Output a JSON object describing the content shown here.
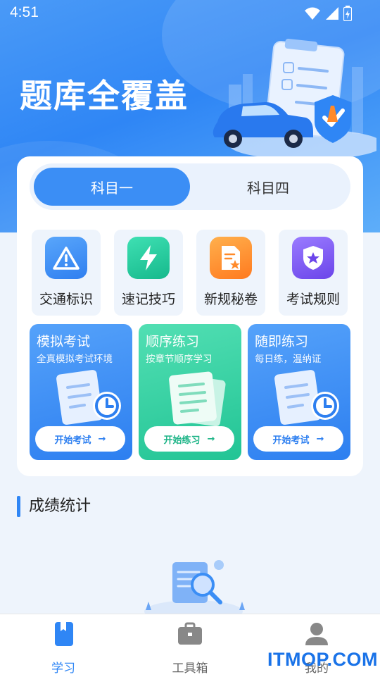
{
  "status_bar": {
    "time": "4:51"
  },
  "hero": {
    "title": "题库全覆盖"
  },
  "subject_tabs": [
    {
      "label": "科目一",
      "active": true
    },
    {
      "label": "科目四",
      "active": false
    }
  ],
  "quick_entries": [
    {
      "label": "交通标识",
      "icon": "warning-icon",
      "color": "#2f86f5"
    },
    {
      "label": "速记技巧",
      "icon": "lightning-icon",
      "color": "#1fc49b"
    },
    {
      "label": "新规秘卷",
      "icon": "document-star-icon",
      "color": "#ff8a2a"
    },
    {
      "label": "考试规则",
      "icon": "shield-star-icon",
      "color": "#7a55f2"
    }
  ],
  "practice_modes": [
    {
      "title": "模拟考试",
      "subtitle": "全真模拟考试环境",
      "button": "开始考试",
      "color": "#3b8ef5"
    },
    {
      "title": "顺序练习",
      "subtitle": "按章节顺序学习",
      "button": "开始练习",
      "color": "#2ccf9e"
    },
    {
      "title": "随即练习",
      "subtitle": "每日练，温纳证",
      "button": "开始考试",
      "color": "#3b8ef5"
    }
  ],
  "section": {
    "title": "成绩统计"
  },
  "bottom_nav": [
    {
      "label": "学习",
      "icon": "bookmark-book-icon",
      "active": true
    },
    {
      "label": "工具箱",
      "icon": "toolbox-icon",
      "active": false
    },
    {
      "label": "我的",
      "icon": "user-icon",
      "active": false
    }
  ],
  "watermark": "ITMOP.COM"
}
